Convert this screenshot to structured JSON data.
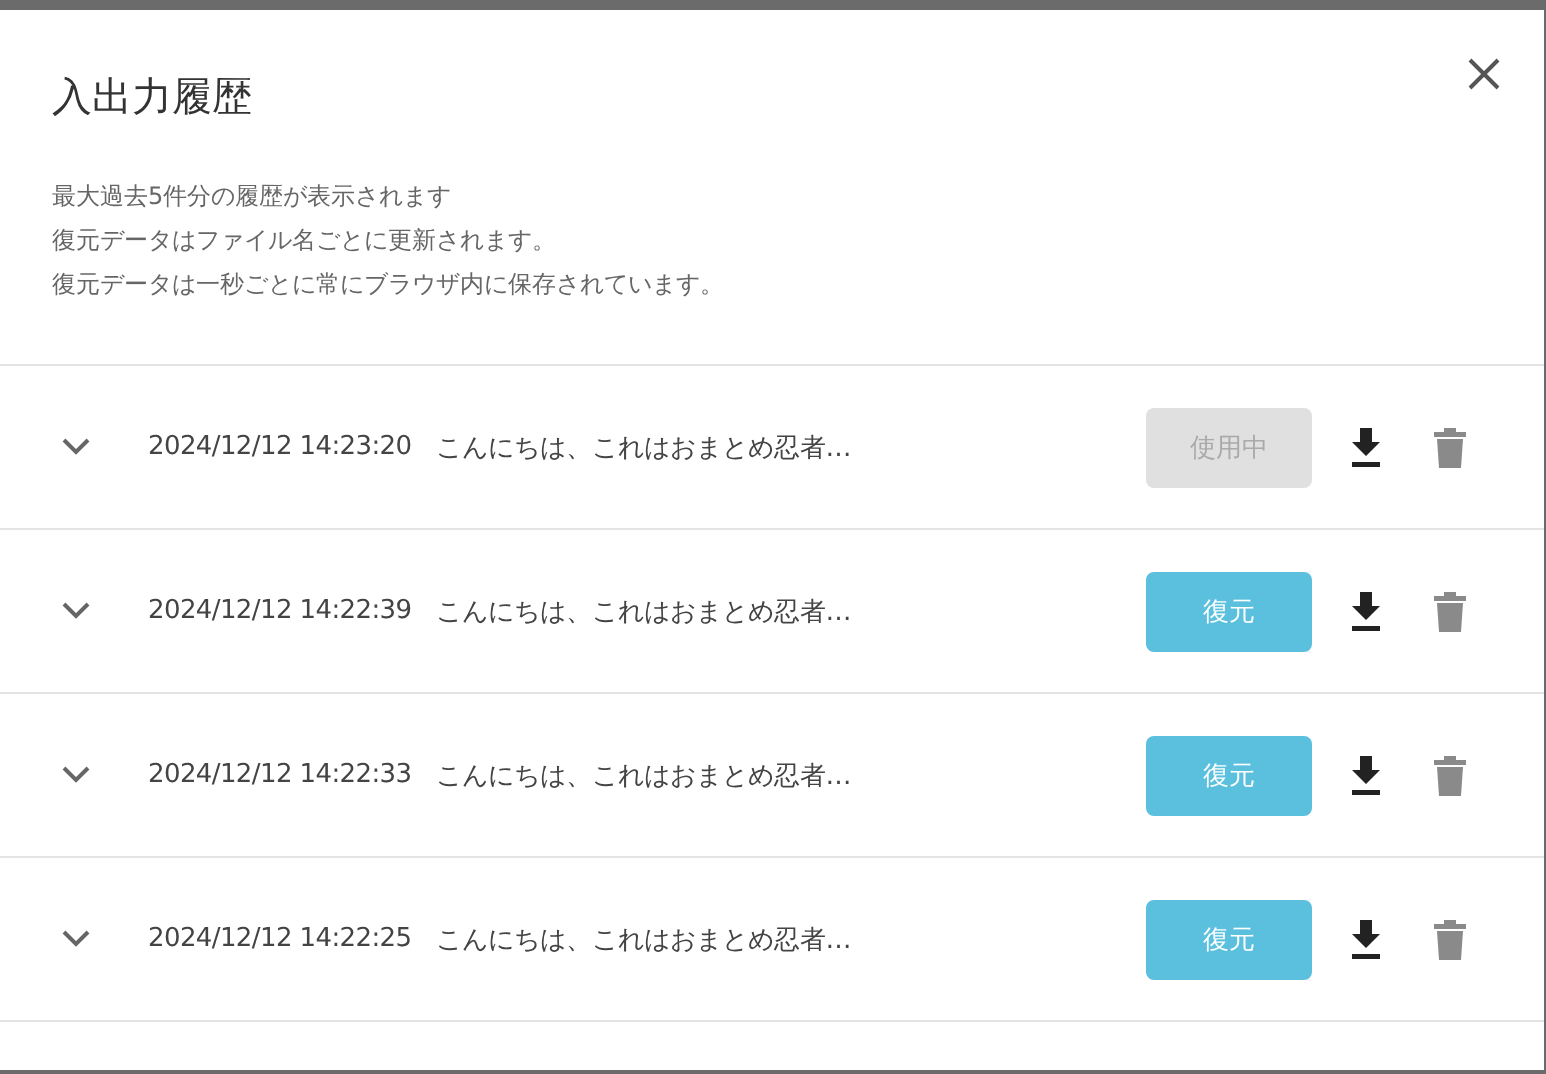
{
  "dialog": {
    "title": "入出力履歴",
    "notes": [
      "最大過去5件分の履歴が表示されます",
      "復元データはファイル名ごとに更新されます。",
      "復元データは一秒ごとに常にブラウザ内に保存されています。"
    ]
  },
  "history": [
    {
      "timestamp": "2024/12/12 14:23:20",
      "summary": "こんにちは、これはおまとめ忍者…",
      "action": "使用中",
      "in_use": true
    },
    {
      "timestamp": "2024/12/12 14:22:39",
      "summary": "こんにちは、これはおまとめ忍者…",
      "action": "復元",
      "in_use": false
    },
    {
      "timestamp": "2024/12/12 14:22:33",
      "summary": "こんにちは、これはおまとめ忍者…",
      "action": "復元",
      "in_use": false
    },
    {
      "timestamp": "2024/12/12 14:22:25",
      "summary": "こんにちは、これはおまとめ忍者…",
      "action": "復元",
      "in_use": false
    }
  ]
}
